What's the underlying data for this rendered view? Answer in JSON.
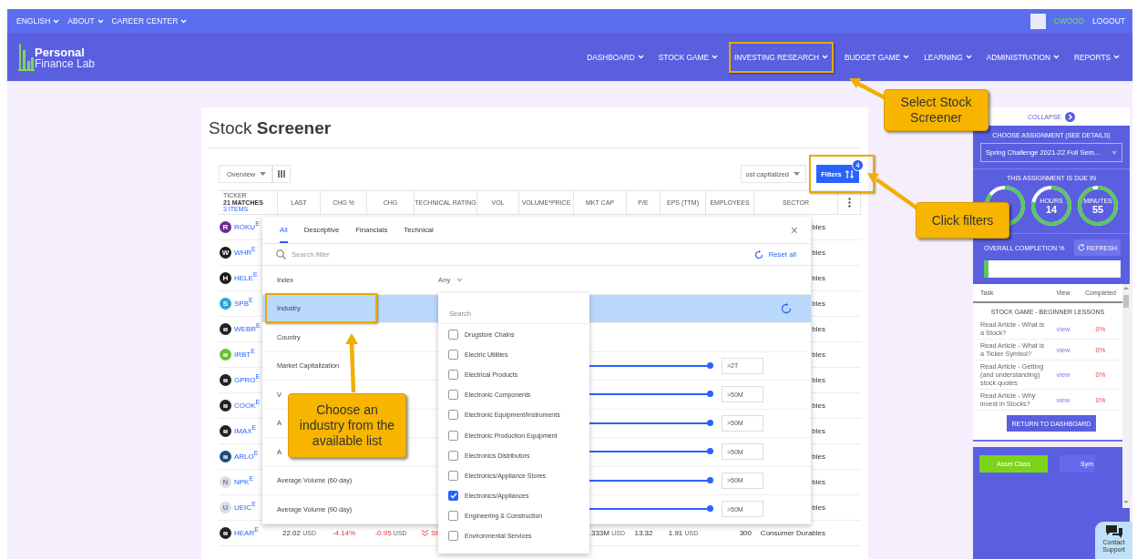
{
  "top_bar": {
    "links": [
      {
        "label": "ENGLISH"
      },
      {
        "label": "ABOUT"
      },
      {
        "label": "CAREER CENTER"
      }
    ],
    "user": "CWOOD",
    "logout": "LOGOUT"
  },
  "brand": {
    "line_1": "Personal",
    "line_2": "Finance Lab"
  },
  "nav": [
    {
      "label": "DASHBOARD",
      "highlighted": false
    },
    {
      "label": "STOCK GAME",
      "highlighted": false
    },
    {
      "label": "INVESTING RESEARCH",
      "highlighted": true
    },
    {
      "label": "BUDGET GAME",
      "highlighted": false
    },
    {
      "label": "LEARNING",
      "highlighted": false
    },
    {
      "label": "ADMINISTRATION",
      "highlighted": false
    },
    {
      "label": "REPORTS",
      "highlighted": false
    }
  ],
  "screener": {
    "title": "Stock **Screener**",
    "view_select": "Overview",
    "sort_select": "ost capitalized",
    "filters_button": "Filters",
    "filters_count": "4",
    "filters_highlighted": true,
    "ticker_header": {
      "label": "TICKER",
      "matches": "21 MATCHES",
      "items": "3 ITEMS"
    },
    "columns": [
      "LAST",
      "CHG %",
      "CHG",
      "TECHNICAL RATING",
      "VOL",
      "VOLUME*PRICE",
      "MKT CAP",
      "P/E",
      "EPS (TTM)",
      "EMPLOYEES",
      "SECTOR"
    ],
    "rows": [
      {
        "ticker": "ROKU",
        "exchange": "E",
        "logo": "R",
        "color": "#6c2c91",
        "sector": "bles"
      },
      {
        "ticker": "WHR",
        "exchange": "E",
        "logo": "W",
        "color": "#1c1c1c",
        "sector": "bles"
      },
      {
        "ticker": "HELE",
        "exchange": "E",
        "logo": "H",
        "color": "#1c1c1c",
        "sector": "bles"
      },
      {
        "ticker": "SPB",
        "exchange": "E",
        "logo": "S",
        "color": "#2aa4d8",
        "sector": "bles"
      },
      {
        "ticker": "WEBR",
        "exchange": "E",
        "color": "#222222",
        "sector": "bles"
      },
      {
        "ticker": "IRBT",
        "exchange": "E",
        "color": "#6bbf2f",
        "sector": "bles"
      },
      {
        "ticker": "GPRO",
        "exchange": "E",
        "color": "#222222",
        "sector": "bles"
      },
      {
        "ticker": "COOK",
        "exchange": "E",
        "color": "#222222",
        "sector": "bles"
      },
      {
        "ticker": "IMAX",
        "exchange": "E",
        "color": "#222222",
        "sector": "bles"
      },
      {
        "ticker": "ARLO",
        "exchange": "E",
        "color": "#1b4f7a",
        "sector": "bles"
      },
      {
        "ticker": "NPK",
        "exchange": "E",
        "logo": "N",
        "color": "#dcdde8",
        "sector": "bles"
      },
      {
        "ticker": "UEIC",
        "exchange": "E",
        "logo": "U",
        "color": "#dcdde8",
        "sector": "bles"
      },
      {
        "ticker": "HEAR",
        "exchange": "E",
        "color": "#222222",
        "negative": true,
        "last": {
          "value": "22.02",
          "unit": "USD"
        },
        "chg_pct": "-4.14%",
        "chg": {
          "value": "-0.95",
          "unit": "USD"
        },
        "technical_rating": "St",
        "mkt_cap": {
          "value": ".333M",
          "unit": "USD"
        },
        "pe": "13.32",
        "eps": {
          "value": "1.91",
          "unit": "USD"
        },
        "employees": "300",
        "sector": "Consumer Durables"
      }
    ]
  },
  "filter_panel": {
    "tabs": [
      {
        "label": "All",
        "selected": true
      },
      {
        "label": "Descriptive",
        "selected": false
      },
      {
        "label": "Financials",
        "selected": false
      },
      {
        "label": "Technical",
        "selected": false
      }
    ],
    "close": "×",
    "search_placeholder": "Search filter",
    "reset_all": "Reset all",
    "filters": [
      {
        "label": "Index",
        "kind": "select",
        "value": "Any",
        "selected": false,
        "highlighted": false
      },
      {
        "label": "Industry",
        "kind": "list",
        "selected": true,
        "highlighted": true
      },
      {
        "label": "Country",
        "kind": "plain",
        "selected": false,
        "highlighted": false
      },
      {
        "label": "Market Capitalization",
        "kind": "range",
        "level": 1,
        "value": ">2T",
        "selected": false,
        "highlighted": false
      },
      {
        "label": "V",
        "kind": "range",
        "level": 1,
        "value": ">50M",
        "selected": false,
        "highlighted": false
      },
      {
        "label": "A",
        "kind": "range",
        "level": 1,
        "value": ">50M",
        "selected": false,
        "highlighted": false
      },
      {
        "label": "A",
        "kind": "range",
        "level": 1,
        "value": ">50M",
        "selected": false,
        "highlighted": false
      },
      {
        "label": "Average Volume (60 day)",
        "kind": "range",
        "level": 1,
        "value": ">50M",
        "selected": false,
        "highlighted": false
      },
      {
        "label": "Average Volume (90 day)",
        "kind": "range",
        "level": 1,
        "value": ">50M",
        "selected": false,
        "highlighted": false
      }
    ]
  },
  "industry_list": {
    "placeholder": "Search",
    "options": [
      {
        "label": "Drugstore Chains",
        "checked": false
      },
      {
        "label": "Electric Utilities",
        "checked": false
      },
      {
        "label": "Electrical Products",
        "checked": false
      },
      {
        "label": "Electronic Components",
        "checked": false
      },
      {
        "label": "Electronic Equipment/Instruments",
        "checked": false
      },
      {
        "label": "Electronic Production Equipment",
        "checked": false
      },
      {
        "label": "Electronics Distributors",
        "checked": false
      },
      {
        "label": "Electronics/Appliance Stores",
        "checked": false
      },
      {
        "label": "Electronics/Appliances",
        "checked": true
      },
      {
        "label": "Engineering & Construction",
        "checked": false
      },
      {
        "label": "Environmental Services",
        "checked": false
      }
    ]
  },
  "assignment_panel": {
    "collapse": "COLLAPSE",
    "choose_label": "CHOOSE ASSIGNMENT (SEE DETAILS)",
    "assignment": "Spring Challenge 2021-22 Full Sem...",
    "due_label": "THIS ASSIGNMENT IS DUE IN",
    "countdown": [
      {
        "kind": "ring"
      },
      {
        "kind": "ring",
        "unit": "HOURS",
        "value": "14"
      },
      {
        "kind": "ring",
        "unit": "MINUTES",
        "value": "55"
      }
    ],
    "completion_label": "OVERALL COMPLETION %",
    "refresh": "REFRESH",
    "progress": {
      "level": 0.03
    },
    "task_columns": [
      "Task",
      "View",
      "Completed"
    ],
    "section": "STOCK GAME - BEGINNER LESSONS",
    "tasks": [
      {
        "task": "Read Article - What is a Stock?",
        "view": "view",
        "completed": "0%"
      },
      {
        "task": "Read Article - What is a Ticker Symbol?",
        "view": "view",
        "completed": "0%"
      },
      {
        "task": "Read Article - Getting (and understanding) stock quotes",
        "view": "view",
        "completed": "0%"
      },
      {
        "task": "Read Article - Why invest in Stocks?",
        "view": "view",
        "completed": "0%"
      }
    ],
    "return_button": "RETURN TO DASHBOARD",
    "category_buttons": [
      {
        "label": "Asset Class",
        "kind": "green"
      },
      {
        "label": "Sym",
        "kind": "blue"
      }
    ]
  },
  "contact_support": "Contact Support",
  "callouts": [
    {
      "text": "Select Stock Screener"
    },
    {
      "text": "Click filters"
    },
    {
      "text": "Choose an industry from the available list"
    }
  ]
}
